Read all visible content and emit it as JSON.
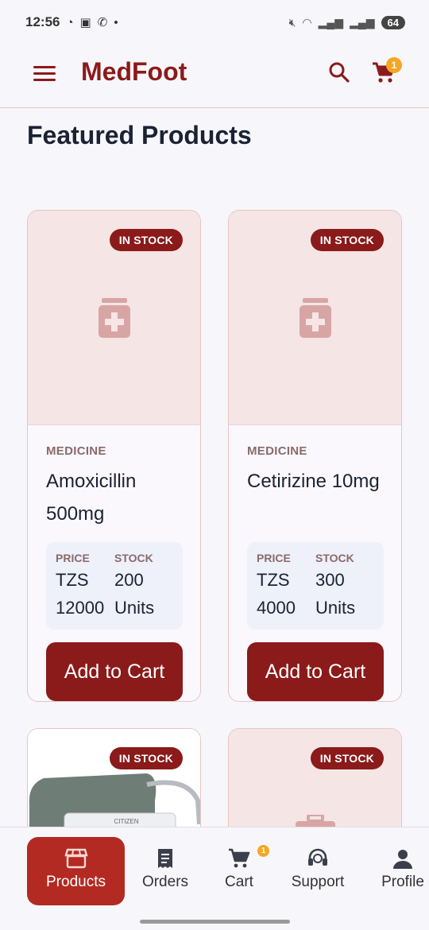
{
  "status_bar": {
    "time": "12:56",
    "battery": "64"
  },
  "app_bar": {
    "title": "MedFoot",
    "cart_count": "1"
  },
  "page": {
    "title": "Featured Products"
  },
  "products": [
    {
      "badge": "IN STOCK",
      "category": "MEDICINE",
      "name": "Amoxicillin 500mg",
      "price_label": "PRICE",
      "price_currency": "TZS",
      "price_value": "12000",
      "stock_label": "STOCK",
      "stock_value": "200",
      "stock_unit": "Units",
      "button": "Add to Cart"
    },
    {
      "badge": "IN STOCK",
      "category": "MEDICINE",
      "name": "Cetirizine 10mg",
      "price_label": "PRICE",
      "price_currency": "TZS",
      "price_value": "4000",
      "stock_label": "STOCK",
      "stock_value": "300",
      "stock_unit": "Units",
      "button": "Add to Cart"
    },
    {
      "badge": "IN STOCK",
      "image_brand": "CITIZEN"
    },
    {
      "badge": "IN STOCK"
    }
  ],
  "bottom_nav": {
    "items": [
      {
        "label": "Products",
        "icon": "store-icon",
        "active": true
      },
      {
        "label": "Orders",
        "icon": "receipt-icon"
      },
      {
        "label": "Cart",
        "icon": "cart-icon",
        "badge": "1"
      },
      {
        "label": "Support",
        "icon": "headset-icon"
      },
      {
        "label": "Profile",
        "icon": "person-icon"
      }
    ]
  },
  "colors": {
    "brand": "#8b1a1a",
    "nav_active": "#b32a22",
    "badge_accent": "#f5a623",
    "thumb_bg": "#f6e5e5"
  }
}
